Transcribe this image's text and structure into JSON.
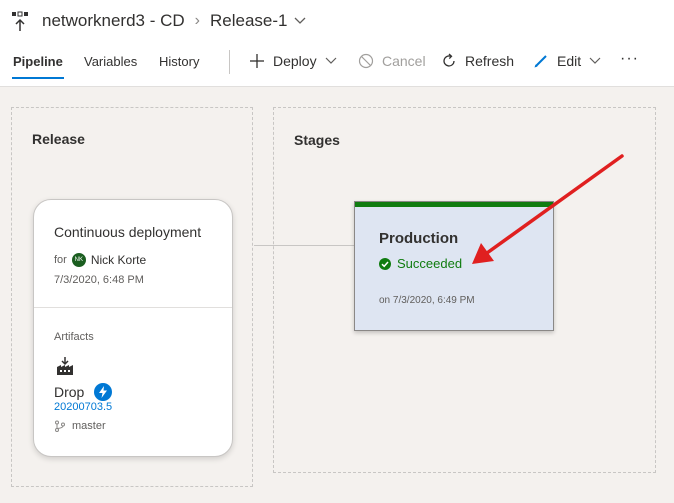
{
  "header": {
    "pipeline_name": "networknerd3 - CD",
    "release_name": "Release-1"
  },
  "tabs": [
    {
      "label": "Pipeline",
      "active": true
    },
    {
      "label": "Variables",
      "active": false
    },
    {
      "label": "History",
      "active": false
    }
  ],
  "toolbar": {
    "deploy_label": "Deploy",
    "cancel_label": "Cancel",
    "refresh_label": "Refresh",
    "edit_label": "Edit",
    "more_label": "···"
  },
  "release_panel": {
    "title": "Release",
    "trigger_title": "Continuous deployment",
    "for_label": "for",
    "user_initials": "NK",
    "user_name": "Nick Korte",
    "timestamp": "7/3/2020, 6:48 PM",
    "artifacts_label": "Artifacts",
    "artifact_name": "Drop",
    "artifact_version": "20200703.5",
    "branch": "master"
  },
  "stages_panel": {
    "title": "Stages",
    "stage_name": "Production",
    "status": "Succeeded",
    "completed": "on 7/3/2020, 6:49 PM"
  },
  "colors": {
    "accent": "#0078d4",
    "success": "#107c10",
    "stage_background": "#dee5f2",
    "annotation_arrow": "#e02020"
  }
}
